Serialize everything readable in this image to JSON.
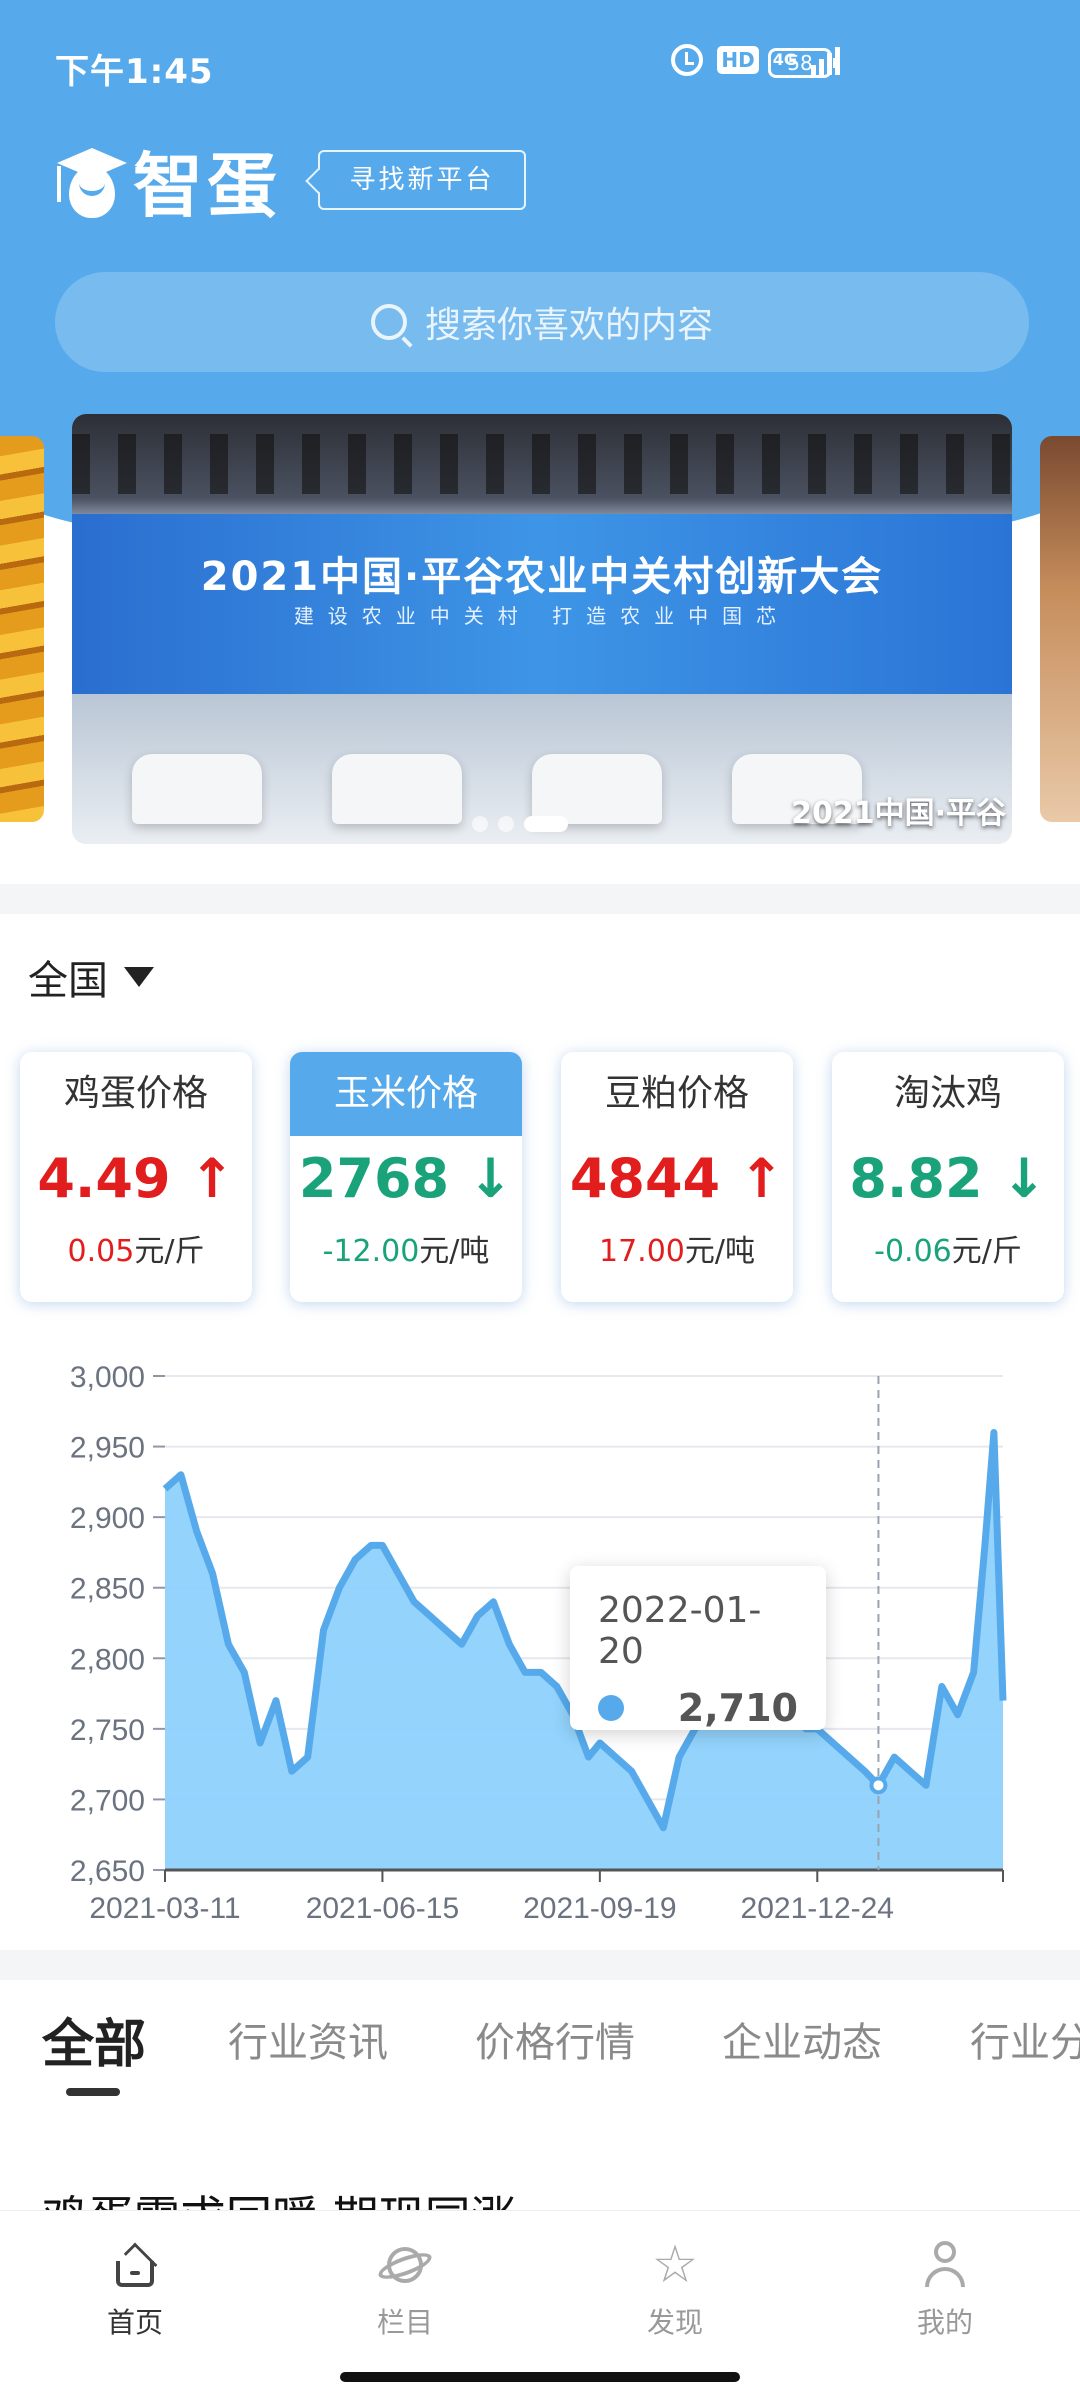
{
  "status_bar": {
    "time": "下午1:45",
    "hd": "HD",
    "network": "4G",
    "battery": "58"
  },
  "header": {
    "logo_text": "智蛋",
    "tag": "寻找新平台",
    "search_placeholder": "搜索你喜欢的内容"
  },
  "banner": {
    "title": "2021中国·平谷农业中关村创新大会",
    "subtitle": "建设农业中关村 打造农业中国芯",
    "caption": "2021中国·平谷",
    "active_index": 2,
    "total": 3
  },
  "region": {
    "label": "全国"
  },
  "price_cards": [
    {
      "title": "鸡蛋价格",
      "value": "4.49",
      "trend": "up",
      "change": "0.05",
      "unit": "元/斤",
      "active": false
    },
    {
      "title": "玉米价格",
      "value": "2768",
      "trend": "down",
      "change": "-12.00",
      "unit": "元/吨",
      "active": true
    },
    {
      "title": "豆粕价格",
      "value": "4844",
      "trend": "up",
      "change": "17.00",
      "unit": "元/吨",
      "active": false
    },
    {
      "title": "淘汰鸡",
      "value": "8.82",
      "trend": "down",
      "change": "-0.06",
      "unit": "元/斤",
      "active": false
    }
  ],
  "chart_data": {
    "type": "area",
    "x_ticks": [
      "2021-03-11",
      "2021-06-15",
      "2021-09-19",
      "2021-12-24"
    ],
    "y_ticks": [
      "2,650",
      "2,700",
      "2,750",
      "2,800",
      "2,850",
      "2,900",
      "2,950",
      "3,000"
    ],
    "ylim": [
      2650,
      3000
    ],
    "x_range": [
      "2021-03-11",
      "2022-03-16"
    ],
    "grid": true,
    "color": "#56aaec",
    "fill_color": "#8dd1fc",
    "x": [
      "2021-03-11",
      "2021-03-18",
      "2021-03-25",
      "2021-04-01",
      "2021-04-08",
      "2021-04-15",
      "2021-04-22",
      "2021-04-29",
      "2021-05-06",
      "2021-05-13",
      "2021-05-20",
      "2021-05-27",
      "2021-06-03",
      "2021-06-10",
      "2021-06-15",
      "2021-06-22",
      "2021-06-29",
      "2021-07-06",
      "2021-07-13",
      "2021-07-20",
      "2021-07-27",
      "2021-08-03",
      "2021-08-10",
      "2021-08-17",
      "2021-08-24",
      "2021-08-31",
      "2021-09-07",
      "2021-09-14",
      "2021-09-19",
      "2021-09-26",
      "2021-10-03",
      "2021-10-10",
      "2021-10-17",
      "2021-10-24",
      "2021-10-31",
      "2021-11-07",
      "2021-11-14",
      "2021-11-21",
      "2021-11-28",
      "2021-12-05",
      "2021-12-12",
      "2021-12-19",
      "2021-12-24",
      "2021-12-31",
      "2022-01-07",
      "2022-01-14",
      "2022-01-20",
      "2022-01-27",
      "2022-02-03",
      "2022-02-10",
      "2022-02-17",
      "2022-02-24",
      "2022-03-03",
      "2022-03-08",
      "2022-03-12",
      "2022-03-16"
    ],
    "values": [
      2920,
      2930,
      2890,
      2860,
      2810,
      2790,
      2740,
      2770,
      2720,
      2730,
      2820,
      2850,
      2870,
      2880,
      2880,
      2860,
      2840,
      2830,
      2820,
      2810,
      2830,
      2840,
      2810,
      2790,
      2790,
      2780,
      2760,
      2730,
      2740,
      2730,
      2720,
      2700,
      2680,
      2730,
      2750,
      2760,
      2770,
      2760,
      2770,
      2760,
      2760,
      2750,
      2750,
      2740,
      2730,
      2720,
      2710,
      2730,
      2720,
      2710,
      2780,
      2760,
      2790,
      2880,
      2960,
      2770
    ],
    "tooltip": {
      "date": "2022-01-20",
      "value": "2,710"
    }
  },
  "tabs": [
    {
      "label": "全部",
      "active": true
    },
    {
      "label": "行业资讯",
      "active": false
    },
    {
      "label": "价格行情",
      "active": false
    },
    {
      "label": "企业动态",
      "active": false
    },
    {
      "label": "行业分",
      "active": false
    }
  ],
  "article": {
    "title": "鸡蛋需求回暖 期现同涨"
  },
  "bottom_nav": [
    {
      "label": "首页",
      "icon": "home-icon",
      "active": true
    },
    {
      "label": "栏目",
      "icon": "planet-icon",
      "active": false
    },
    {
      "label": "发现",
      "icon": "star-icon",
      "active": false
    },
    {
      "label": "我的",
      "icon": "user-icon",
      "active": false
    }
  ]
}
